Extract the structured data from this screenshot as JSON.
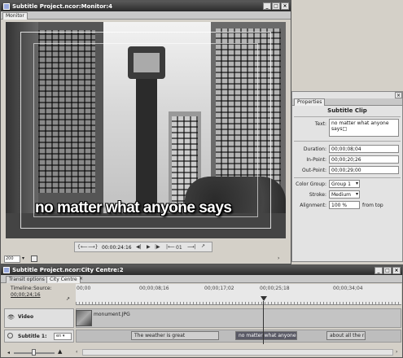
{
  "monitor": {
    "title": "Subtitle Project.ncor:Monitor:4",
    "tab": "Monitor",
    "subtitle_preview": "no matter what anyone says",
    "timecode": "00:00:24:16",
    "frame_label": "01",
    "zoom_value": "200"
  },
  "properties": {
    "tab": "Properties",
    "heading": "Subtitle Clip",
    "text_label": "Text:",
    "text_value": "no matter what anyone says□",
    "duration_label": "Duration:",
    "duration_value": "00;00;08;04",
    "in_label": "In-Point:",
    "in_value": "00;00;20;26",
    "out_label": "Out-Point:",
    "out_value": "00;00;29;00",
    "color_group_label": "Color Group:",
    "color_group_value": "Group 1",
    "stroke_label": "Stroke:",
    "stroke_value": "Medium",
    "alignment_label": "Alignment:",
    "alignment_value": "100 %",
    "alignment_suffix": "from top"
  },
  "timeline": {
    "title": "Subtitle Project.ncor:City Centre:2",
    "tabs": [
      "Transit options",
      "City Centre"
    ],
    "timeline_label": "Timeline:",
    "source_label": "Source:",
    "timeline_time": "00;00;24;16",
    "ruler_ticks": [
      "00;00",
      "00;00;08;16",
      "00;00;17;02",
      "00;00;25;18",
      "00;00;34;04"
    ],
    "video_track_label": "Video",
    "video_clip": "monument.JPG",
    "subtitle_track_label": "Subtitle 1:",
    "subtitle_lang": "en",
    "subtitle_clips": [
      "The weather is great",
      "no matter what anyone says",
      "about all the rain..."
    ]
  },
  "colors": {
    "titlebar": "#3a3a3a",
    "selected_clip": "#5a5a66",
    "subtitle_clip": "#cfcfcf",
    "playhead": "#333333"
  }
}
